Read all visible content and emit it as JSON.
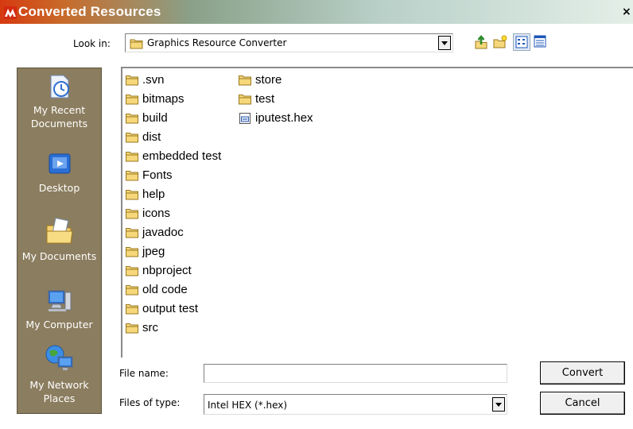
{
  "window": {
    "title": "Converted Resources",
    "close_glyph": "×"
  },
  "lookin": {
    "label": "Look in:",
    "value": "Graphics Resource Converter"
  },
  "toolbar": {
    "up_icon": "up-folder-icon",
    "new_folder_icon": "new-folder-icon",
    "list_view_icon": "list-view-icon",
    "details_view_icon": "details-view-icon"
  },
  "places": [
    {
      "label": "My Recent Documents",
      "icon": "recent-documents-icon"
    },
    {
      "label": "Desktop",
      "icon": "desktop-icon"
    },
    {
      "label": "My Documents",
      "icon": "my-documents-icon"
    },
    {
      "label": "My Computer",
      "icon": "my-computer-icon"
    },
    {
      "label": "My Network Places",
      "icon": "network-places-icon"
    }
  ],
  "files": {
    "column1": [
      ".svn",
      "bitmaps",
      "build",
      "dist",
      "embedded test",
      "Fonts",
      "help",
      "icons",
      "javadoc",
      "jpeg",
      "nbproject",
      "old code",
      "output test",
      "src"
    ],
    "column2": [
      {
        "name": "store",
        "type": "folder"
      },
      {
        "name": "test",
        "type": "folder"
      },
      {
        "name": "iputest.hex",
        "type": "file"
      }
    ]
  },
  "filename": {
    "label": "File name:",
    "value": ""
  },
  "filetype": {
    "label": "Files of type:",
    "value": "Intel HEX (*.hex)"
  },
  "buttons": {
    "convert": "Convert",
    "cancel": "Cancel"
  },
  "colors": {
    "places_bg": "#8b7d5f",
    "title_start": "#d63a10",
    "title_end": "#e4efe8"
  }
}
